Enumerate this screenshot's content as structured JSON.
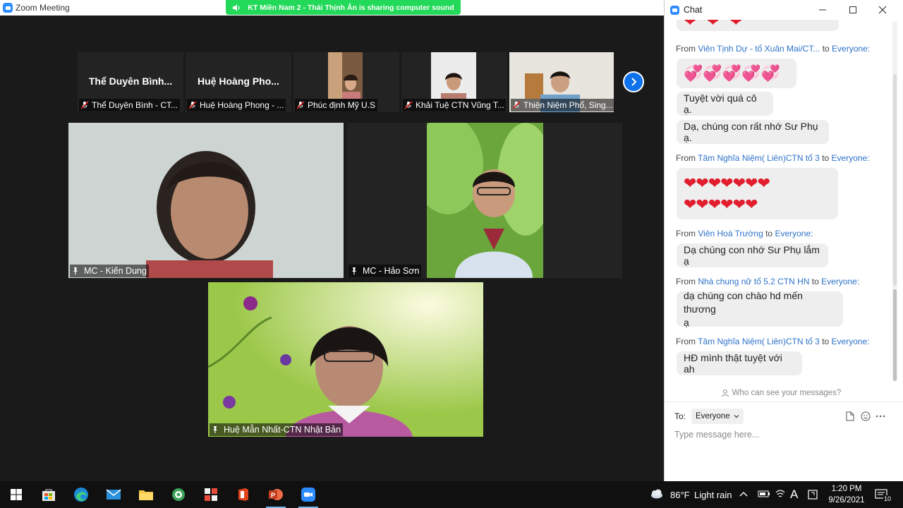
{
  "zoom": {
    "window_title": "Zoom Meeting",
    "share_banner": "KT Miền Nam 2 - Thái Thịnh Ân is sharing computer sound",
    "filmstrip": [
      {
        "display_name": "Thể Duyên Bình...",
        "label": "Thể Duyên Bình - CT..."
      },
      {
        "display_name": "Huệ Hoàng Pho...",
        "label": "Huệ Hoàng Phong - ..."
      },
      {
        "display_name": "",
        "label": "Phúc định Mỹ U.S"
      },
      {
        "display_name": "",
        "label": "Khải Tuệ CTN Vũng T..."
      },
      {
        "display_name": "",
        "label": "Thiện Niệm Phổ, Sing..."
      }
    ],
    "tiles": [
      {
        "label": "MC - Kiến Dung"
      },
      {
        "label": "MC - Hảo Sơn"
      },
      {
        "label": "Huệ Mẫn Nhất-CTN Nhật Bản"
      }
    ]
  },
  "chat": {
    "title": "Chat",
    "messages": [
      {
        "from_prefix": "From",
        "sender": "Viên Tịnh Dự - tổ Xuân Mai/CT...",
        "to_word": "to",
        "recipient": "Everyone:",
        "text": "💞💞💞💞💞"
      },
      {
        "text": "Tuyệt vời quá cô ạ."
      },
      {
        "text": "Dạ, chúng con rất nhớ Sư Phụ ạ."
      },
      {
        "from_prefix": "From",
        "sender": "Tâm Nghĩa Niệm( Liên)CTN tổ 3",
        "to_word": "to",
        "recipient": "Everyone:",
        "line1": "❤❤❤❤❤❤❤",
        "line2": "❤❤❤❤❤❤"
      },
      {
        "from_prefix": "From",
        "sender": "Viên Hoà Trường",
        "to_word": "to",
        "recipient": "Everyone:",
        "text": "Dạ chúng con nhớ Sư Phụ lắm ạ"
      },
      {
        "from_prefix": "From",
        "sender": "Nhà chung nữ tổ 5.2 CTN HN",
        "to_word": "to",
        "recipient": "Everyone:",
        "line1": "dạ chúng con chào hd mến thương",
        "line2": "ạ"
      },
      {
        "from_prefix": "From",
        "sender": "Tâm Nghĩa Niệm( Liên)CTN tổ 3",
        "to_word": "to",
        "recipient": "Everyone:",
        "text": "HĐ mình thật tuyệt với ah"
      }
    ],
    "top_partial_hearts": "❤ ❤ ❤",
    "who_can_see": "Who can see your messages?",
    "to_label": "To:",
    "to_value": "Everyone",
    "input_placeholder": "Type message here..."
  },
  "taskbar": {
    "weather_temp": "86°F",
    "weather_desc": "Light rain",
    "time": "1:20 PM",
    "date": "9/26/2021",
    "notification_count": "10"
  },
  "colors": {
    "share_banner": "#23d959",
    "sender_blue": "#2d72c8",
    "zoom_blue": "#2d8cff",
    "heart_red": "#e21d2d"
  }
}
